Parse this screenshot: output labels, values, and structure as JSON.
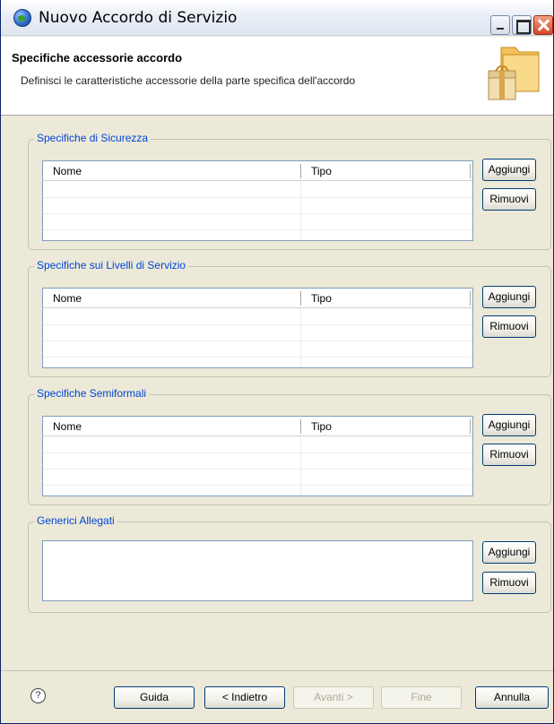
{
  "window": {
    "title": "Nuovo Accordo di Servizio",
    "minimize_icon": "minimize-icon",
    "maximize_icon": "maximize-icon",
    "close_icon": "close-icon"
  },
  "banner": {
    "title": "Specifiche accessorie accordo",
    "description": "Definisci le caratteristiche accessorie della parte specifica dell'accordo",
    "icon": "package-folder-icon"
  },
  "groups": [
    {
      "label": "Specifiche di Sicurezza",
      "columns": [
        "Nome",
        "Tipo"
      ],
      "rows": [],
      "add_label": "Aggiungi",
      "remove_label": "Rimuovi"
    },
    {
      "label": "Specifiche sui Livelli di Servizio",
      "columns": [
        "Nome",
        "Tipo"
      ],
      "rows": [],
      "add_label": "Aggiungi",
      "remove_label": "Rimuovi"
    },
    {
      "label": "Specifiche Semiformali",
      "columns": [
        "Nome",
        "Tipo"
      ],
      "rows": [],
      "add_label": "Aggiungi",
      "remove_label": "Rimuovi"
    }
  ],
  "attachments": {
    "label": "Generici Allegati",
    "items": [],
    "add_label": "Aggiungi",
    "remove_label": "Rimuovi"
  },
  "footer": {
    "help_icon": "help-icon",
    "help_glyph": "?",
    "guide_label": "Guida",
    "back_label": "< Indietro",
    "next_label": "Avanti >",
    "finish_label": "Fine",
    "cancel_label": "Annulla",
    "next_enabled": false,
    "finish_enabled": false
  }
}
